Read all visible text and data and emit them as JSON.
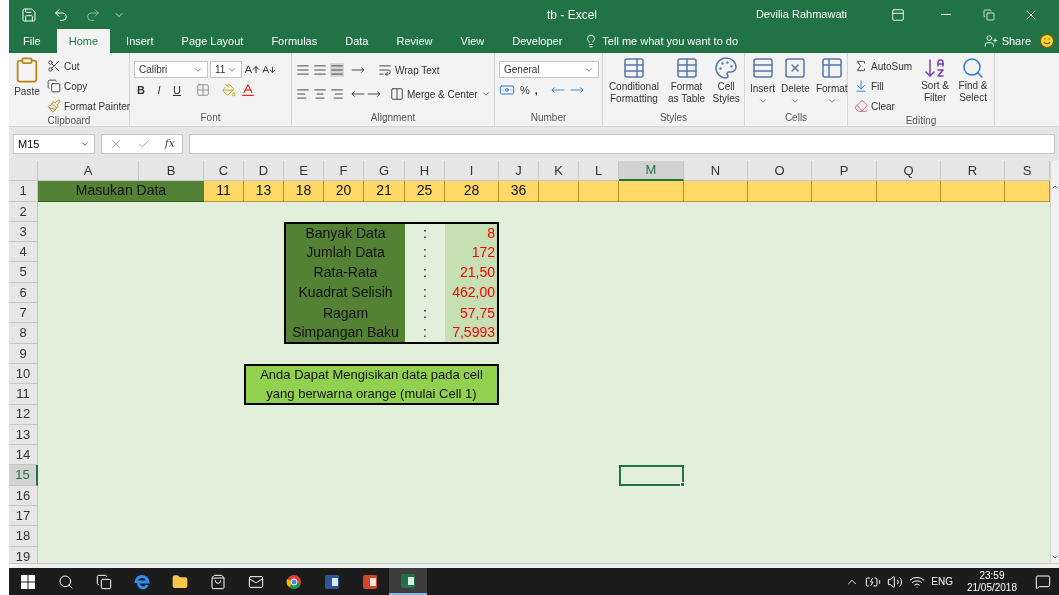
{
  "title_bar": {
    "title": "tb - Excel",
    "user": "Devilia Rahmawati"
  },
  "menu_tabs": [
    {
      "label": "File",
      "selected": false
    },
    {
      "label": "Home",
      "selected": true
    },
    {
      "label": "Insert",
      "selected": false
    },
    {
      "label": "Page Layout",
      "selected": false
    },
    {
      "label": "Formulas",
      "selected": false
    },
    {
      "label": "Data",
      "selected": false
    },
    {
      "label": "Review",
      "selected": false
    },
    {
      "label": "View",
      "selected": false
    },
    {
      "label": "Developer",
      "selected": false
    }
  ],
  "tell_me": "Tell me what you want to do",
  "share": "Share",
  "ribbon": {
    "clipboard": {
      "label": "Clipboard",
      "paste": "Paste",
      "cut": "Cut",
      "copy": "Copy",
      "format_painter": "Format Painter"
    },
    "font": {
      "label": "Font",
      "font_name": "Calibri",
      "font_size": "11",
      "bold": "B",
      "italic": "I",
      "underline": "U"
    },
    "alignment": {
      "label": "Alignment",
      "wrap_text": "Wrap Text",
      "merge_center": "Merge & Center"
    },
    "number": {
      "label": "Number",
      "format": "General",
      "percent": "%",
      "comma": ","
    },
    "styles": {
      "label": "Styles",
      "buttons": [
        "Conditional Formatting",
        "Format as Table",
        "Cell Styles"
      ]
    },
    "cells": {
      "label": "Cells",
      "buttons": [
        "Insert",
        "Delete",
        "Format"
      ]
    },
    "editing": {
      "label": "Editing",
      "autosum": "AutoSum",
      "fill": "Fill",
      "clear": "Clear",
      "buttons": [
        "Sort & Filter",
        "Find & Select"
      ]
    }
  },
  "formula_bar": {
    "name_box": "M15",
    "fx": "fx"
  },
  "sheet": {
    "columns": [
      {
        "label": "A",
        "selected": false
      },
      {
        "label": "B",
        "selected": false
      },
      {
        "label": "C",
        "selected": false
      },
      {
        "label": "D",
        "selected": false
      },
      {
        "label": "E",
        "selected": false
      },
      {
        "label": "F",
        "selected": false
      },
      {
        "label": "G",
        "selected": false
      },
      {
        "label": "H",
        "selected": false
      },
      {
        "label": "I",
        "selected": false
      },
      {
        "label": "J",
        "selected": false
      },
      {
        "label": "K",
        "selected": false
      },
      {
        "label": "L",
        "selected": false
      },
      {
        "label": "M",
        "selected": true
      },
      {
        "label": "N",
        "selected": false
      },
      {
        "label": "O",
        "selected": false
      },
      {
        "label": "P",
        "selected": false
      },
      {
        "label": "Q",
        "selected": false
      },
      {
        "label": "R",
        "selected": false
      },
      {
        "label": "S",
        "selected": false
      }
    ],
    "rows": [
      {
        "label": "1",
        "selected": false
      },
      {
        "label": "2",
        "selected": false
      },
      {
        "label": "3",
        "selected": false
      },
      {
        "label": "4",
        "selected": false
      },
      {
        "label": "5",
        "selected": false
      },
      {
        "label": "6",
        "selected": false
      },
      {
        "label": "7",
        "selected": false
      },
      {
        "label": "8",
        "selected": false
      },
      {
        "label": "9",
        "selected": false
      },
      {
        "label": "10",
        "selected": false
      },
      {
        "label": "11",
        "selected": false
      },
      {
        "label": "12",
        "selected": false
      },
      {
        "label": "13",
        "selected": false
      },
      {
        "label": "14",
        "selected": false
      },
      {
        "label": "15",
        "selected": true
      },
      {
        "label": "16",
        "selected": false
      },
      {
        "label": "17",
        "selected": false
      },
      {
        "label": "18",
        "selected": false
      },
      {
        "label": "19",
        "selected": false
      }
    ],
    "input_row": {
      "label": "Masukan Data",
      "values": [
        "11",
        "13",
        "18",
        "20",
        "21",
        "25",
        "28",
        "36"
      ]
    },
    "summary": [
      {
        "label": "Banyak Data",
        "separator": ":",
        "value": "8"
      },
      {
        "label": "Jumlah Data",
        "separator": ":",
        "value": "172"
      },
      {
        "label": "Rata-Rata",
        "separator": ":",
        "value": "21,50"
      },
      {
        "label": "Kuadrat Selisih",
        "separator": ":",
        "value": "462,00"
      },
      {
        "label": "Ragam",
        "separator": ":",
        "value": "57,75"
      },
      {
        "label": "Simpangan Baku",
        "separator": ":",
        "value": "7,5993"
      }
    ],
    "note_lines": [
      "Anda Dapat Mengisikan data pada cell",
      "yang berwarna orange (mulai Cell 1)"
    ]
  },
  "taskbar": {
    "language": "ENG",
    "time": "23:59",
    "date": "21/05/2018"
  }
}
